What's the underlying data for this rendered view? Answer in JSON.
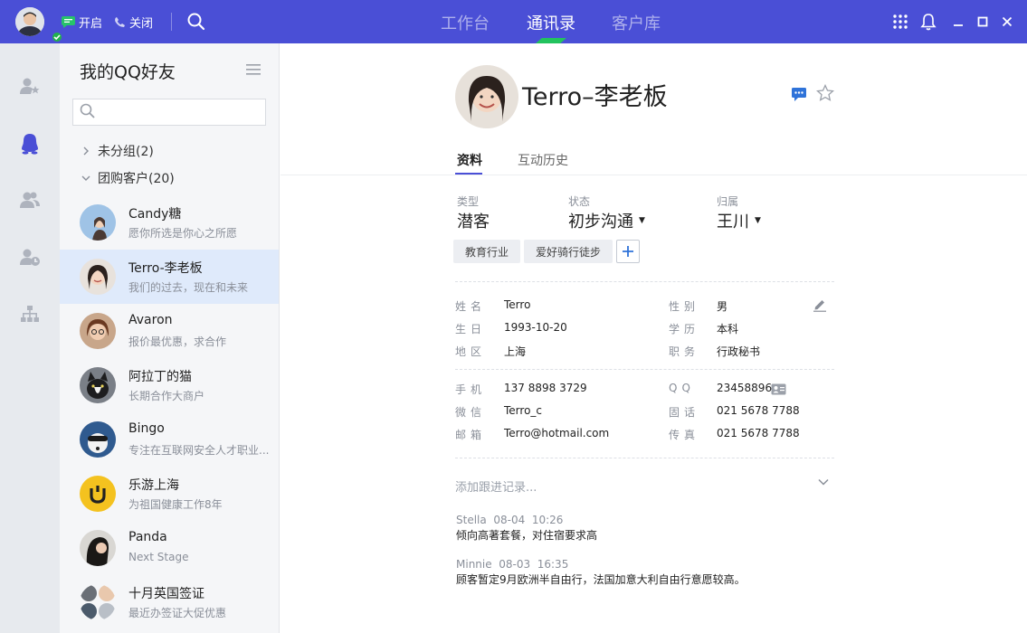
{
  "topbar": {
    "open_label": "开启",
    "close_label": "关闭",
    "nav_tabs": [
      "工作台",
      "通讯录",
      "客户库"
    ],
    "active_tab": "通讯录",
    "accent_color": "#4a4fd6",
    "indicator_color": "#22c35e"
  },
  "friends": {
    "title": "我的QQ好友",
    "search_placeholder": "",
    "groups": [
      {
        "label": "未分组(2)",
        "expanded": false
      },
      {
        "label": "团购客户(20)",
        "expanded": true
      }
    ],
    "contacts": [
      {
        "name": "Candy糖",
        "signature": "愿你所选是你心之所愿"
      },
      {
        "name": "Terro-李老板",
        "signature": "我们的过去，现在和未来",
        "selected": true
      },
      {
        "name": "Avaron",
        "signature": "报价最优惠，求合作"
      },
      {
        "name": "阿拉丁的猫",
        "signature": "长期合作大商户"
      },
      {
        "name": "Bingo",
        "signature": "专注在互联网安全人才职业..."
      },
      {
        "name": "乐游上海",
        "signature": "为祖国健康工作8年"
      },
      {
        "name": "Panda",
        "signature": "Next Stage"
      },
      {
        "name": "十月英国签证",
        "signature": "最近办签证大促优惠"
      }
    ]
  },
  "detail": {
    "name": "Terro–李老板",
    "tabs": [
      "资料",
      "互动历史"
    ],
    "active_tab": "资料",
    "meta": [
      {
        "label": "类型",
        "value": "潜客"
      },
      {
        "label": "状态",
        "value": "初步沟通"
      },
      {
        "label": "归属",
        "value": "王川"
      }
    ],
    "tags": [
      "教育行业",
      "爱好骑行徒步"
    ],
    "fields": [
      {
        "label": "姓名",
        "value": "Terro"
      },
      {
        "label": "性别",
        "value": "男"
      },
      {
        "label": "生日",
        "value": "1993-10-20"
      },
      {
        "label": "学历",
        "value": "本科"
      },
      {
        "label": "地区",
        "value": "上海"
      },
      {
        "label": "职务",
        "value": "行政秘书"
      },
      {
        "label": "手机",
        "value": "137 8898 3729"
      },
      {
        "label": "QQ",
        "value": "23458896"
      },
      {
        "label": "微信",
        "value": "Terro_c"
      },
      {
        "label": "固话",
        "value": "021 5678 7788"
      },
      {
        "label": "邮箱",
        "value": "Terro@hotmail.com"
      },
      {
        "label": "传真",
        "value": "021 5678 7788"
      }
    ],
    "add_record_placeholder": "添加跟进记录...",
    "records": [
      {
        "meta": "Stella  08-04  10:26",
        "text": "倾向高著套餐，对住宿要求高"
      },
      {
        "meta": "Minnie  08-03  16:35",
        "text": "顾客暂定9月欧洲半自由行，法国加意大利自由行意愿较高。"
      }
    ]
  }
}
